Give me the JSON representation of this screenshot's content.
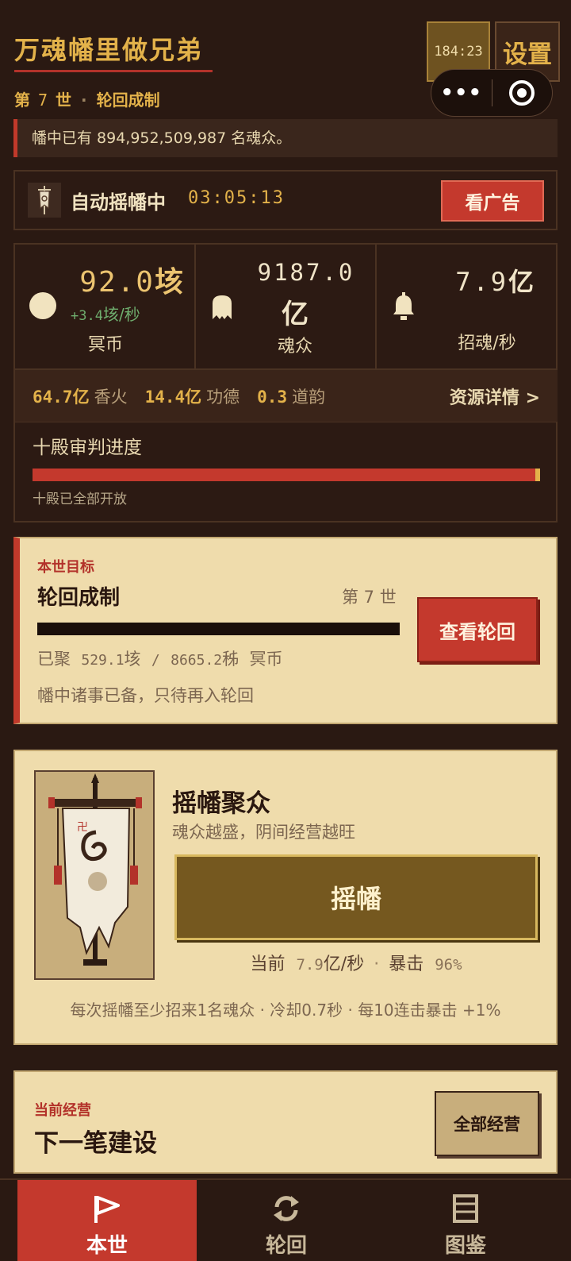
{
  "header": {
    "title": "万魂幡里做兄弟",
    "generation_prefix": "第",
    "generation_number": "7",
    "generation_suffix": "世",
    "separator": "·",
    "era_name": "轮回成制",
    "timer": "184:23",
    "settings_label": "设置",
    "more_icon": "•••"
  },
  "notice": {
    "text": "幡中已有 894,952,509,987 名魂众。"
  },
  "auto": {
    "label": "自动摇幡中",
    "time": "03:05:13",
    "ad_button": "看广告"
  },
  "stats": {
    "coin": {
      "value": "92.0",
      "unit": "垓",
      "rate_value": "+3.4",
      "rate_unit": "垓/秒",
      "label": "冥币"
    },
    "souls": {
      "value": "9187.0",
      "unit": "亿",
      "label": "魂众"
    },
    "summon": {
      "value": "7.9",
      "unit": "亿",
      "label_a": "招魂",
      "label_b": "/秒"
    }
  },
  "resources": {
    "incense": {
      "value": "64.7",
      "unit": "亿",
      "label": "香火"
    },
    "merit": {
      "value": "14.4",
      "unit": "亿",
      "label": "功德"
    },
    "dao": {
      "value": "0.3",
      "label": "道韵"
    },
    "detail_link": "资源详情 >"
  },
  "judgement": {
    "title": "十殿审判进度",
    "progress": 1.0,
    "note": "十殿已全部开放"
  },
  "goal": {
    "kicker": "本世目标",
    "title": "轮回成制",
    "generation": "第 7 世",
    "progress_prefix": "已聚",
    "progress_current": "529.1",
    "progress_current_unit": "垓",
    "progress_sep": "/",
    "progress_target": "8665.2",
    "progress_target_unit": "秭",
    "progress_currency": "冥币",
    "status": "幡中诸事已备，只待再入轮回",
    "button": "查看轮回"
  },
  "shake": {
    "title": "摇幡聚众",
    "desc": "魂众越盛，阴间经营越旺",
    "button": "摇幡",
    "current_label": "当前",
    "current_value": "7.9",
    "current_unit": "亿/秒",
    "crit_label": "暴击",
    "crit_value": "96%",
    "dot": "·",
    "rule": "每次摇幡至少招来1名魂众 · 冷却0.7秒 · 每10连击暴击 +1%"
  },
  "manage": {
    "kicker": "当前经营",
    "title": "下一笔建设",
    "button": "全部经营"
  },
  "tabs": [
    {
      "label": "本世",
      "icon": "flag-icon",
      "active": true
    },
    {
      "label": "轮回",
      "icon": "cycle-icon",
      "active": false
    },
    {
      "label": "图鉴",
      "icon": "list-icon",
      "active": false
    }
  ],
  "colors": {
    "background": "#2a1912",
    "gold": "#e3b24a",
    "red": "#c4392d",
    "parchment": "#efdcac"
  }
}
